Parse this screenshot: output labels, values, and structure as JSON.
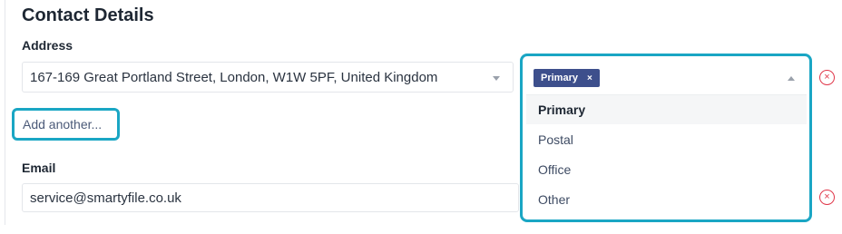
{
  "section": {
    "title": "Contact Details"
  },
  "address": {
    "label": "Address",
    "value": "167-169 Great Portland Street, London, W1W 5PF, United Kingdom",
    "add_another_label": "Add another..."
  },
  "email": {
    "label": "Email",
    "value": "service@smartyfile.co.uk"
  },
  "type_dropdown": {
    "selected_chip": "Primary",
    "chip_remove_glyph": "×",
    "options": [
      "Primary",
      "Postal",
      "Office",
      "Other"
    ]
  },
  "remove_glyph": "×",
  "colors": {
    "focus_ring": "#1aa6c4",
    "chip_bg": "#3d4f8c",
    "danger": "#e0374a"
  }
}
